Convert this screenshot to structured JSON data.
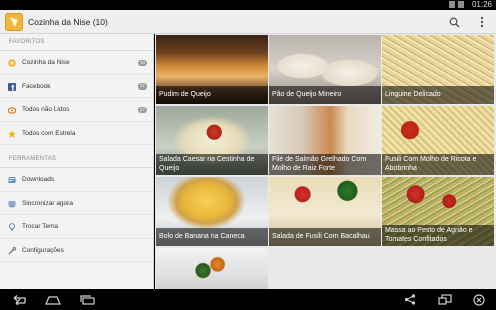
{
  "status_bar": {
    "time": "01:26"
  },
  "action_bar": {
    "title": "Cozinha da Nise (10)",
    "icons": [
      "app-icon",
      "search-icon",
      "overflow-menu-icon"
    ]
  },
  "sidebar": {
    "favorites_header": "FAVORITOS",
    "favorites": [
      {
        "label": "Cozinha da Nise",
        "badge": "10",
        "icon": "feed-icon"
      },
      {
        "label": "Facebook",
        "badge": "17",
        "icon": "facebook-icon"
      },
      {
        "label": "Todos não Lidos",
        "badge": "27",
        "icon": "unread-icon"
      },
      {
        "label": "Todos com Estrela",
        "badge": "",
        "icon": "star-icon"
      }
    ],
    "tools_header": "FERRAMENTAS",
    "tools": [
      {
        "label": "Downloads",
        "icon": "download-icon"
      },
      {
        "label": "Sincronizar agora",
        "icon": "sync-icon"
      },
      {
        "label": "Trocar Tema",
        "icon": "theme-icon"
      },
      {
        "label": "Configurações",
        "icon": "settings-icon"
      }
    ]
  },
  "articles": [
    {
      "title": "Pudim de Queijo"
    },
    {
      "title": "Pão de Queijo Mineiro"
    },
    {
      "title": "Linguine Delicado"
    },
    {
      "title": "Salada Caesar na Cestinha de Queijo"
    },
    {
      "title": "Filé de Salmão Grelhado Com Molho de Raiz Forte"
    },
    {
      "title": "Fusili Com Molho de Ricota e Abobrinha"
    },
    {
      "title": "Bolo de Banana na Caneca"
    },
    {
      "title": "Salada de Fusili Com Bacalhau"
    },
    {
      "title": "Massa ao Pesto de Agrião e Tomates Confitados"
    },
    {
      "title": ""
    }
  ],
  "navigation_bar": {
    "icons": [
      "back-icon",
      "home-icon",
      "recents-icon",
      "share-icon",
      "screen-icon",
      "close-circle-icon"
    ]
  },
  "colors": {
    "action_bar": "#efefef",
    "sidebar": "#f3f3f3",
    "badge": "#9b9b9b",
    "star": "#f2b01e",
    "facebook": "#3b5998"
  }
}
